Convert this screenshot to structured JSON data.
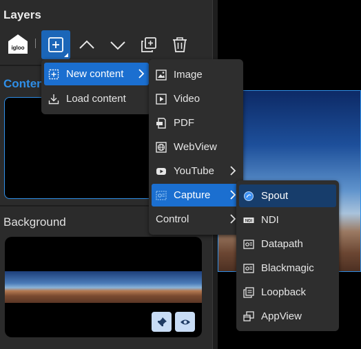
{
  "panel": {
    "title": "Layers",
    "content_label": "Content",
    "background_label": "Background",
    "igloo_logo_text": "igloo"
  },
  "colors": {
    "accent": "#2f8fe8",
    "menu_active": "#1b6fd0",
    "menu_bg": "#2e2e2e",
    "panel_bg": "#2b2b2b"
  },
  "toolbar": {
    "buttons": [
      {
        "icon": "add-square-icon"
      },
      {
        "icon": "chevron-up-icon"
      },
      {
        "icon": "chevron-down-icon"
      },
      {
        "icon": "duplicate-icon"
      },
      {
        "icon": "trash-icon"
      }
    ]
  },
  "menus": {
    "main": [
      {
        "label": "New content",
        "icon": "add-square-icon",
        "submenu": true,
        "active": true
      },
      {
        "label": "Load content",
        "icon": "download-icon",
        "submenu": false
      }
    ],
    "new_content": [
      {
        "label": "Image",
        "icon": "image-icon"
      },
      {
        "label": "Video",
        "icon": "video-icon"
      },
      {
        "label": "PDF",
        "icon": "pdf-icon"
      },
      {
        "label": "WebView",
        "icon": "globe-icon"
      },
      {
        "label": "YouTube",
        "icon": "youtube-icon",
        "submenu": true
      },
      {
        "label": "Capture",
        "icon": "capture-icon",
        "submenu": true,
        "active": true
      },
      {
        "label": "Control",
        "icon": "",
        "submenu": true
      }
    ],
    "capture": [
      {
        "label": "Spout",
        "icon": "spout-icon",
        "active": true
      },
      {
        "label": "NDI",
        "icon": "ndi-icon"
      },
      {
        "label": "Datapath",
        "icon": "datapath-icon"
      },
      {
        "label": "Blackmagic",
        "icon": "blackmagic-icon"
      },
      {
        "label": "Loopback",
        "icon": "loopback-icon"
      },
      {
        "label": "AppView",
        "icon": "appview-icon"
      }
    ]
  },
  "background_card": {
    "buttons": [
      {
        "icon": "pin-icon"
      },
      {
        "icon": "eye-icon"
      }
    ]
  }
}
